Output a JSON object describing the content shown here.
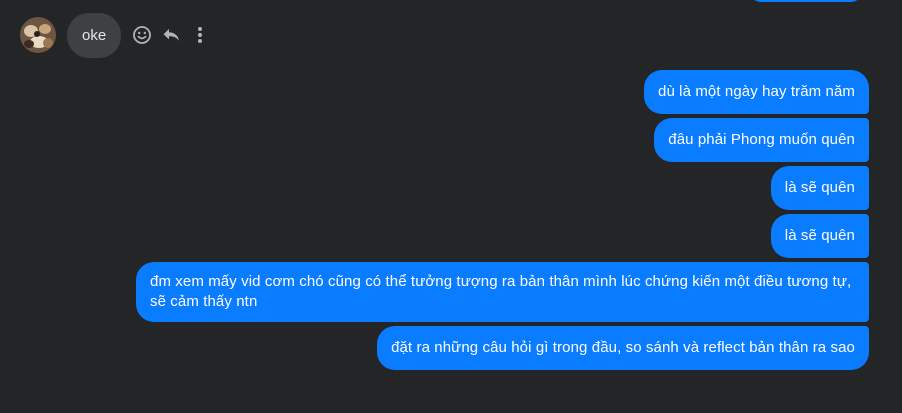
{
  "incoming": {
    "message": "oke",
    "actions": [
      {
        "name": "react-icon"
      },
      {
        "name": "reply-icon"
      },
      {
        "name": "more-icon"
      }
    ]
  },
  "outgoing": [
    {
      "text": "dù là một ngày hay trăm năm"
    },
    {
      "text": "đâu phải Phong muốn quên"
    },
    {
      "text": "là sẽ quên"
    },
    {
      "text": "là sẽ quên"
    },
    {
      "text": "đm xem mấy vid cơm chó cũng có thể tưởng tượng ra bản thân mình lúc chứng kiến một điều tương tự, sẽ cảm thấy ntn"
    },
    {
      "text": "đặt ra những câu hỏi gì trong đầu, so sánh và reflect bản thân ra sao"
    }
  ],
  "colors": {
    "background": "#242526",
    "outgoing_bubble": "#0a7cff",
    "incoming_bubble": "#3e4042",
    "icon": "#b0b3b8"
  }
}
